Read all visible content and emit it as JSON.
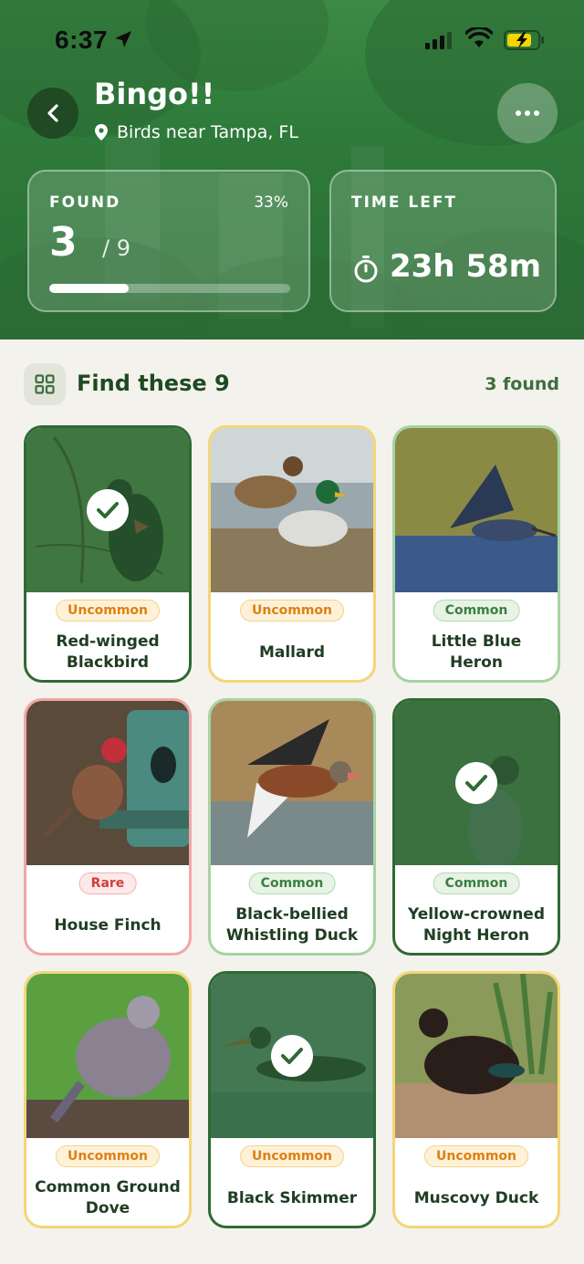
{
  "status_bar": {
    "time": "6:37"
  },
  "header": {
    "title": "Bingo!!",
    "location": "Birds near Tampa, FL"
  },
  "stats": {
    "found_label": "FOUND",
    "found_count": "3",
    "found_total": "/ 9",
    "found_percent": "33%",
    "progress_fraction": 0.33,
    "time_label": "TIME LEFT",
    "time_value": "23h 58m"
  },
  "section": {
    "title": "Find these 9",
    "found_summary": "3 found"
  },
  "birds": [
    {
      "name": "Red-winged Blackbird",
      "rarity": "Uncommon",
      "found": true
    },
    {
      "name": "Mallard",
      "rarity": "Uncommon",
      "found": false
    },
    {
      "name": "Little Blue Heron",
      "rarity": "Common",
      "found": false
    },
    {
      "name": "House Finch",
      "rarity": "Rare",
      "found": false
    },
    {
      "name": "Black-bellied Whistling Duck",
      "rarity": "Common",
      "found": false
    },
    {
      "name": "Yellow-crowned Night Heron",
      "rarity": "Common",
      "found": true
    },
    {
      "name": "Common Ground Dove",
      "rarity": "Uncommon",
      "found": false
    },
    {
      "name": "Black Skimmer",
      "rarity": "Uncommon",
      "found": true
    },
    {
      "name": "Muscovy Duck",
      "rarity": "Uncommon",
      "found": false
    }
  ],
  "colors": {
    "brand_green": "#2e7a3a",
    "dark_green": "#1e4a22",
    "uncommon": "#e07f12",
    "common": "#3a7f42",
    "rare": "#d43b3b"
  }
}
